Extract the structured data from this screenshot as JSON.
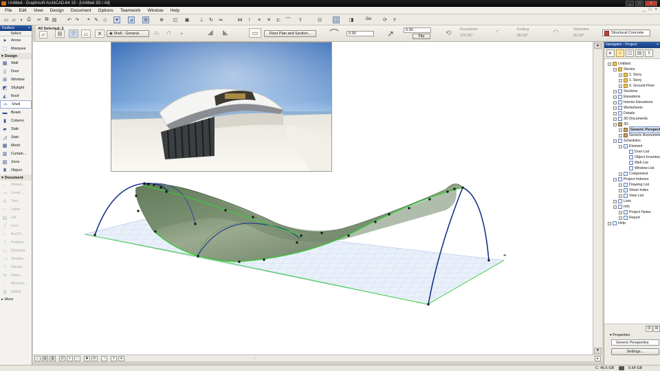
{
  "window": {
    "title": "Untitled - Graphisoft ArchiCAD-64 15 - [Untitled 3D / All]"
  },
  "menu": [
    "File",
    "Edit",
    "View",
    "Design",
    "Document",
    "Options",
    "Teamwork",
    "Window",
    "Help"
  ],
  "menu_controls": [
    "_",
    "□",
    "×"
  ],
  "toolbox": {
    "title": "Toolbox",
    "select_label": "Select",
    "arrow": "Arrow",
    "marquee": "Marquee",
    "design_header": "Design",
    "design_tools": [
      "Wall",
      "Door",
      "Window",
      "Skylight",
      "Roof",
      "Shell",
      "Beam",
      "Column",
      "Slab",
      "Stair",
      "Mesh",
      "Curtain...",
      "Zone",
      "Object"
    ],
    "document_header": "Document",
    "document_tools": [
      "Dimen...",
      "Level ...",
      "Text",
      "Label",
      "Fill",
      "Line",
      "Arc/Ci...",
      "Polyline",
      "Drawing",
      "Section",
      "Elevat...",
      "IInter...",
      "Worksh...",
      "Detail"
    ],
    "more": "More"
  },
  "infobox": {
    "all_selected": "All Selected: 2",
    "shell_type": "Shell - General",
    "floor_plan_btn": "Floor Plan and Section...",
    "thickness": "0.00",
    "offset": "0.30",
    "flip_btn": "Flip",
    "revolution_label": "Revolution",
    "revolution_value": "270.00°",
    "ending_label": "Ending",
    "ending_value": "90.00°",
    "distortion_label": "Distortion",
    "distortion_value": "90.00°",
    "material": "Structural Concrete",
    "go_label": "Go"
  },
  "navigator": {
    "title": "Navigator - Project",
    "tree": [
      {
        "label": "Untitled",
        "level": 0,
        "icon": "fold"
      },
      {
        "label": "Stories",
        "level": 1,
        "icon": "fold"
      },
      {
        "label": "2. Story",
        "level": 2,
        "icon": "fold"
      },
      {
        "label": "1. Story",
        "level": 2,
        "icon": "fold"
      },
      {
        "label": "0. Ground Floor",
        "level": 2,
        "icon": "fold"
      },
      {
        "label": "Sections",
        "level": 1,
        "icon": "doc"
      },
      {
        "label": "Elevations",
        "level": 1,
        "icon": "doc"
      },
      {
        "label": "Interior Elevations",
        "level": 1,
        "icon": "doc"
      },
      {
        "label": "Worksheets",
        "level": 1,
        "icon": "doc"
      },
      {
        "label": "Details",
        "level": 1,
        "icon": "doc"
      },
      {
        "label": "3D Documents",
        "level": 1,
        "icon": "doc"
      },
      {
        "label": "3D",
        "level": 1,
        "icon": "cam"
      },
      {
        "label": "Generic Perspective",
        "level": 2,
        "icon": "cam",
        "selected": true
      },
      {
        "label": "Generic Axonometry",
        "level": 2,
        "icon": "cam"
      },
      {
        "label": "Schedules",
        "level": 1,
        "icon": "doc"
      },
      {
        "label": "Element",
        "level": 2,
        "icon": "doc"
      },
      {
        "label": "Door List",
        "level": 3,
        "icon": "doc"
      },
      {
        "label": "Object Inventory",
        "level": 3,
        "icon": "doc"
      },
      {
        "label": "Wall List",
        "level": 3,
        "icon": "doc"
      },
      {
        "label": "Window List",
        "level": 3,
        "icon": "doc"
      },
      {
        "label": "Component",
        "level": 2,
        "icon": "doc"
      },
      {
        "label": "Project Indexes",
        "level": 1,
        "icon": "doc"
      },
      {
        "label": "Drawing List",
        "level": 2,
        "icon": "doc"
      },
      {
        "label": "Sheet Index",
        "level": 2,
        "icon": "doc"
      },
      {
        "label": "View List",
        "level": 2,
        "icon": "doc"
      },
      {
        "label": "Lists",
        "level": 1,
        "icon": "doc"
      },
      {
        "label": "Info",
        "level": 1,
        "icon": "doc"
      },
      {
        "label": "Project Notes",
        "level": 2,
        "icon": "doc"
      },
      {
        "label": "Report",
        "level": 2,
        "icon": "doc"
      },
      {
        "label": "Help",
        "level": 0,
        "icon": "doc"
      }
    ],
    "properties_label": "Properties",
    "properties_value": "Generic Perspective",
    "settings_btn": "Settings..."
  },
  "status": {
    "disk": "C: 45.6 GB",
    "memory": "5.64 GB"
  },
  "colors": {
    "selection_blue": "#1a3a8c",
    "shell_green": "#5f7a55",
    "edge_green": "#3ad23a",
    "accent_title": "#2b5aa8"
  }
}
